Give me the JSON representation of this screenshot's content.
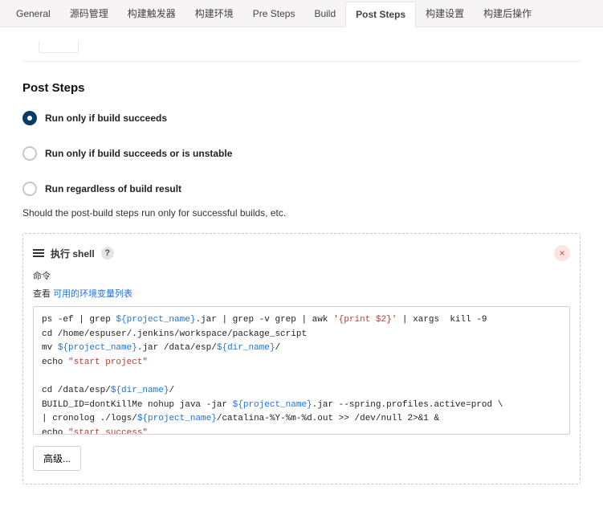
{
  "tabs": {
    "items": [
      {
        "label": "General"
      },
      {
        "label": "源码管理"
      },
      {
        "label": "构建触发器"
      },
      {
        "label": "构建环境"
      },
      {
        "label": "Pre Steps"
      },
      {
        "label": "Build"
      },
      {
        "label": "Post Steps"
      },
      {
        "label": "构建设置"
      },
      {
        "label": "构建后操作"
      }
    ],
    "active_index": 6
  },
  "section": {
    "title": "Post Steps",
    "options": [
      {
        "label": "Run only if build succeeds",
        "checked": true
      },
      {
        "label": "Run only if build succeeds or is unstable",
        "checked": false
      },
      {
        "label": "Run regardless of build result",
        "checked": false
      }
    ],
    "help_text": "Should the post-build steps run only for successful builds, etc."
  },
  "shell": {
    "title": "执行 shell",
    "help_mark": "?",
    "close_mark": "×",
    "command_label": "命令",
    "link_prefix": "查看",
    "link_text": "可用的环境变量列表",
    "advanced_btn": "高级...",
    "code": {
      "l1a": "ps -ef | grep ",
      "l1b": "${project_name}",
      "l1c": ".jar | grep -v grep | awk ",
      "l1d": "'{print $2}'",
      "l1e": " | xargs  kill -9",
      "l2": "cd /home/espuser/.jenkins/workspace/package_script",
      "l3a": "mv ",
      "l3b": "${project_name}",
      "l3c": ".jar /data/esp/",
      "l3d": "${dir_name}",
      "l3e": "/",
      "l4a": "echo ",
      "l4b": "\"start project\"",
      "l5a": "cd /data/esp/",
      "l5b": "${dir_name}",
      "l5c": "/",
      "l6a": "BUILD_ID=dontKillMe nohup java -jar ",
      "l6b": "${project_name}",
      "l6c": ".jar --spring.profiles.active=prod \\",
      "l7a": "| cronolog ./logs/",
      "l7b": "${project_name}",
      "l7c": "/catalina-%Y-%m-%d.out >> /dev/null 2>&1 &",
      "l8a": "echo ",
      "l8b": "\"start success\""
    }
  }
}
